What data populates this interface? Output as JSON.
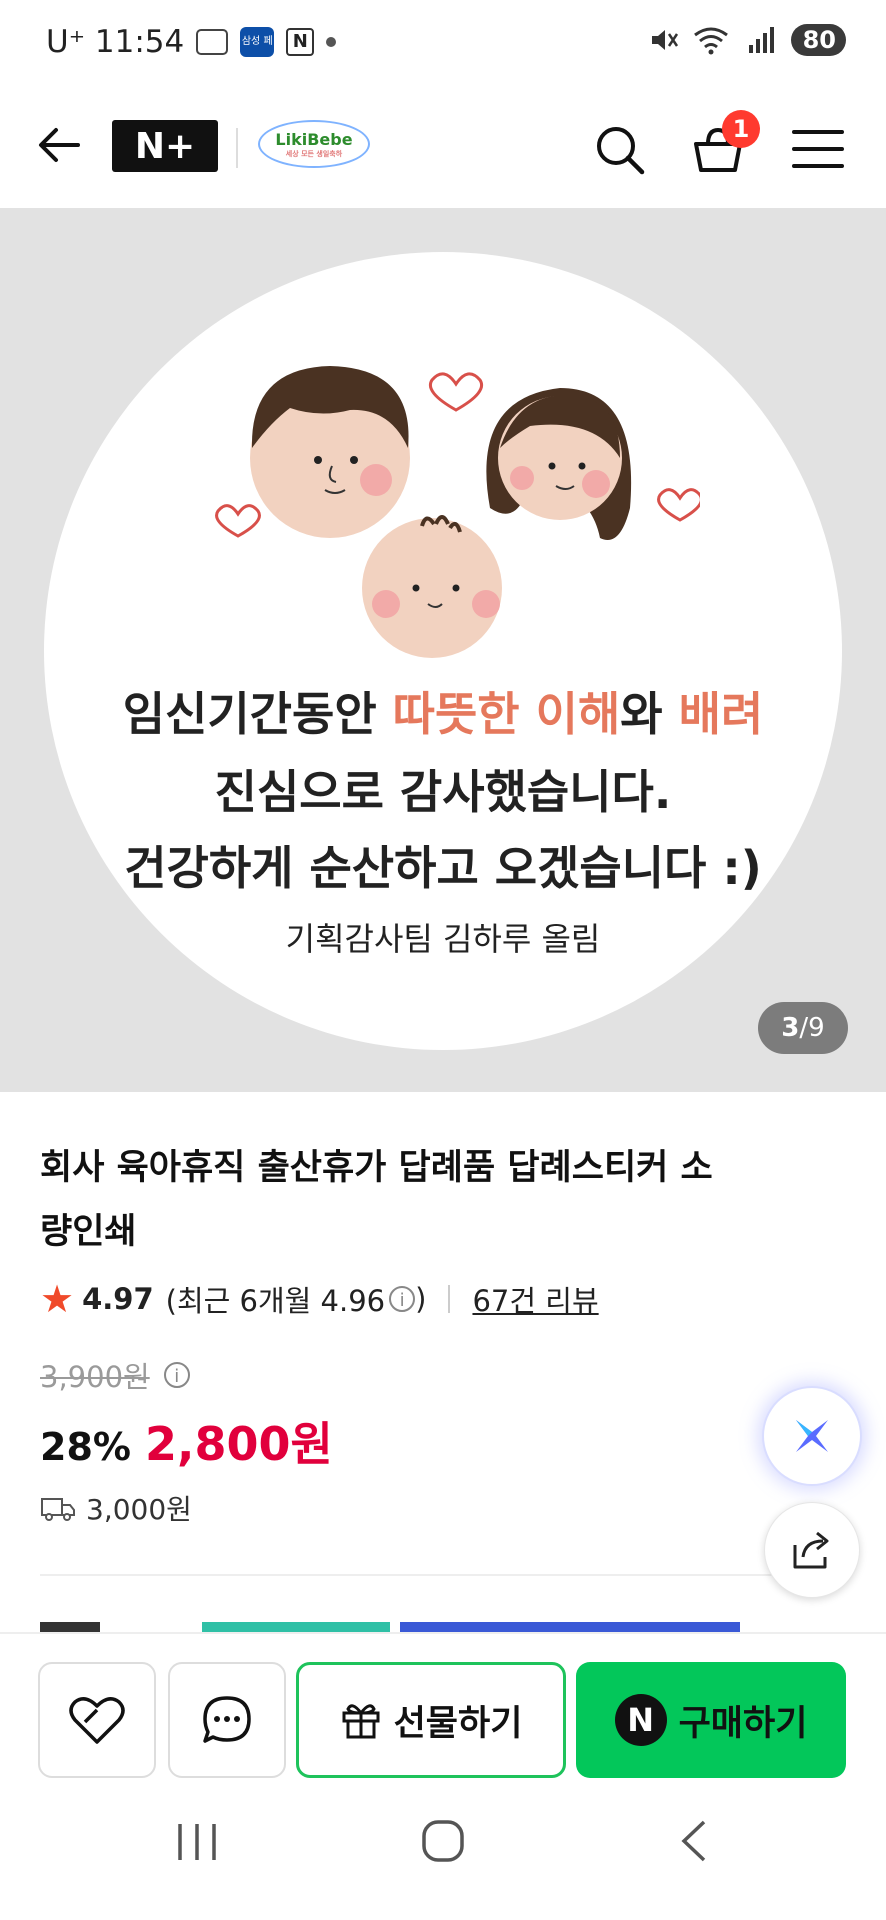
{
  "status_bar": {
    "carrier_time": "U⁺ 11:54",
    "badge_text": "삼성 페이",
    "n_icon": "N",
    "battery": "80"
  },
  "header": {
    "logo_text": "N+",
    "brand_name": "LikiBebe",
    "brand_tag": "세상 모든 생일축하",
    "cart_count": "1"
  },
  "gallery": {
    "sticker_line1_a": "임신기간동안 ",
    "sticker_line1_b": "따뜻한 이해",
    "sticker_line1_c": "와 ",
    "sticker_line1_d": "배려",
    "sticker_line2": "진심으로 감사했습니다.",
    "sticker_line3": "건강하게 순산하고 오겠습니다 :)",
    "sticker_line4": "기획감사팀 김하루 올림",
    "page_current": "3",
    "page_sep": "/",
    "page_total": "9"
  },
  "product": {
    "title": "회사 육아휴직 출산휴가 답례품 답례스티커 소량인쇄",
    "rating": "4.97",
    "recent_rating": "(최근 6개월 4.96",
    "recent_close": ")",
    "review_count": "67건 리뷰",
    "original_price": "3,900원",
    "discount": "28%",
    "price": "2,800원",
    "shipping": "3,000원"
  },
  "actions": {
    "gift_label": "선물하기",
    "buy_label": "구매하기",
    "npay_letter": "N"
  },
  "colors": {
    "accent_green": "#03c75a",
    "price_red": "#e1003c",
    "badge_red": "#ff3a2f",
    "star_orange": "#f04a2a"
  }
}
